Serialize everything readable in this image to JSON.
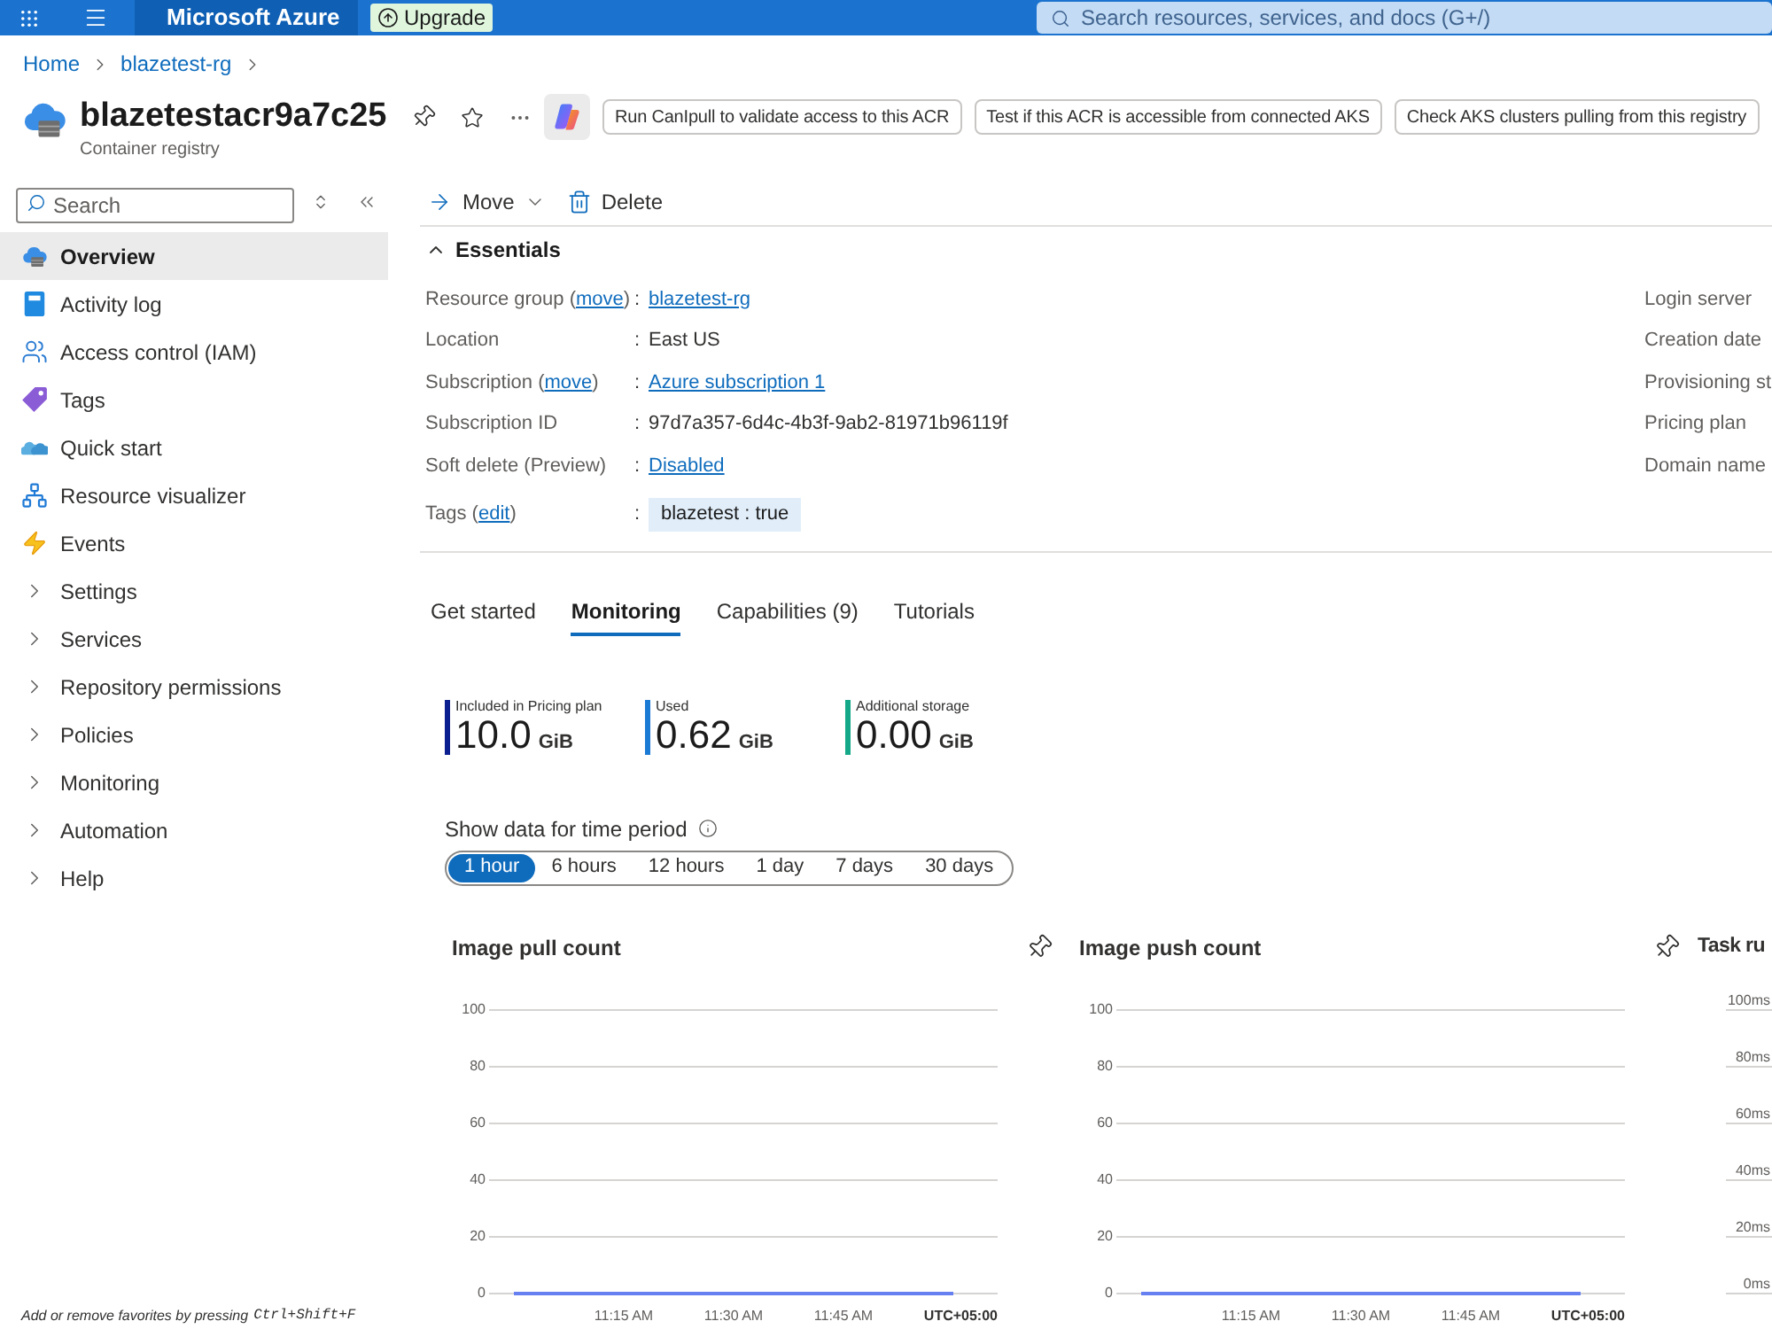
{
  "top_bar": {
    "brand": "Microsoft Azure",
    "upgrade": "Upgrade",
    "search_placeholder": "Search resources, services, and docs (G+/)"
  },
  "breadcrumb": [
    "Home",
    "blazetest-rg"
  ],
  "resource": {
    "name": "blazetestacr9a7c25",
    "type": "Container registry"
  },
  "actions": [
    "Run CanIpull to validate access to this ACR",
    "Test if this ACR is accessible from connected AKS",
    "Check AKS clusters pulling from this registry"
  ],
  "sidebar": {
    "search_placeholder": "Search",
    "items": [
      {
        "label": "Overview",
        "kind": "page",
        "selected": true
      },
      {
        "label": "Activity log",
        "kind": "page",
        "selected": false
      },
      {
        "label": "Access control (IAM)",
        "kind": "page",
        "selected": false
      },
      {
        "label": "Tags",
        "kind": "page",
        "selected": false
      },
      {
        "label": "Quick start",
        "kind": "page",
        "selected": false
      },
      {
        "label": "Resource visualizer",
        "kind": "page",
        "selected": false
      },
      {
        "label": "Events",
        "kind": "page",
        "selected": false
      },
      {
        "label": "Settings",
        "kind": "group",
        "selected": false,
        "expanded": false
      },
      {
        "label": "Services",
        "kind": "group",
        "selected": false,
        "expanded": false
      },
      {
        "label": "Repository permissions",
        "kind": "group",
        "selected": false,
        "expanded": false
      },
      {
        "label": "Policies",
        "kind": "group",
        "selected": false,
        "expanded": false
      },
      {
        "label": "Monitoring",
        "kind": "group",
        "selected": false,
        "expanded": false
      },
      {
        "label": "Automation",
        "kind": "group",
        "selected": false,
        "expanded": false
      },
      {
        "label": "Help",
        "kind": "group",
        "selected": false,
        "expanded": false
      }
    ],
    "favorites_hint": "Add or remove favorites by pressing",
    "shortcut": "Ctrl+Shift+F"
  },
  "toolbar": [
    {
      "label": "Move",
      "kind": "dropdown"
    },
    {
      "label": "Delete",
      "kind": "button"
    }
  ],
  "essentials": {
    "title": "Essentials",
    "expanded": true,
    "separator": ":",
    "left": [
      {
        "label": "Resource group (",
        "label_link": "move",
        "label_end": ")",
        "value": "blazetest-rg",
        "linked": true
      },
      {
        "label": "Location",
        "value": "East US",
        "linked": false
      },
      {
        "label": "Subscription (",
        "label_link": "move",
        "label_end": ")",
        "value": "Azure subscription 1",
        "linked": true
      },
      {
        "label": "Subscription ID",
        "value": "97d7a357-6d4c-4b3f-9ab2-81971b96119f",
        "linked": false
      },
      {
        "label": "Soft delete (Preview)",
        "value": "Disabled",
        "linked": true
      }
    ],
    "tags": {
      "label": "Tags (",
      "label_link": "edit",
      "label_end": ")",
      "items": [
        "blazetest : true"
      ]
    },
    "right": [
      "Login server",
      "Creation date",
      "Provisioning st",
      "Pricing plan",
      "Domain name"
    ]
  },
  "tabs": [
    {
      "label": "Get started",
      "selected": false
    },
    {
      "label": "Monitoring",
      "selected": true
    },
    {
      "label": "Capabilities (9)",
      "selected": false
    },
    {
      "label": "Tutorials",
      "selected": false
    }
  ],
  "metrics": [
    {
      "label": "Included in Pricing plan",
      "value": "10.0",
      "unit": "GiB",
      "color": "#0c1f8f"
    },
    {
      "label": "Used",
      "value": "0.62",
      "unit": "GiB",
      "color": "#1a7ad4"
    },
    {
      "label": "Additional storage",
      "value": "0.00",
      "unit": "GiB",
      "color": "#14a889"
    }
  ],
  "time_period": {
    "label": "Show data for time period",
    "options": [
      {
        "label": "1 hour",
        "selected": true
      },
      {
        "label": "6 hours",
        "selected": false
      },
      {
        "label": "12 hours",
        "selected": false
      },
      {
        "label": "1 day",
        "selected": false
      },
      {
        "label": "7 days",
        "selected": false
      },
      {
        "label": "30 days",
        "selected": false
      }
    ]
  },
  "charts": [
    {
      "chart_data": {
        "type": "line",
        "title": "Image pull count",
        "xlabel": "UTC+05:00",
        "categories": [
          null,
          "11:15 AM",
          "11:30 AM",
          "11:45 AM",
          null
        ],
        "series": [
          {
            "color": "#6680f2",
            "values": [
              0,
              0,
              0,
              0,
              0
            ]
          }
        ],
        "ylim": [
          0,
          100
        ],
        "yticks": [
          0,
          20,
          40,
          60,
          80,
          100
        ],
        "grid": true
      }
    },
    {
      "chart_data": {
        "type": "line",
        "title": "Image push count",
        "xlabel": "UTC+05:00",
        "categories": [
          null,
          "11:15 AM",
          "11:30 AM",
          "11:45 AM",
          null
        ],
        "series": [
          {
            "color": "#6680f2",
            "values": [
              0,
              0,
              0,
              0,
              0
            ]
          }
        ],
        "ylim": [
          0,
          100
        ],
        "yticks": [
          0,
          20,
          40,
          60,
          80,
          100
        ],
        "grid": true
      }
    }
  ],
  "cut_chart": {
    "title": "Task ru",
    "tick_labels": [
      "100ms",
      "80ms",
      "60ms",
      "40ms",
      "20ms",
      "0ms"
    ]
  }
}
